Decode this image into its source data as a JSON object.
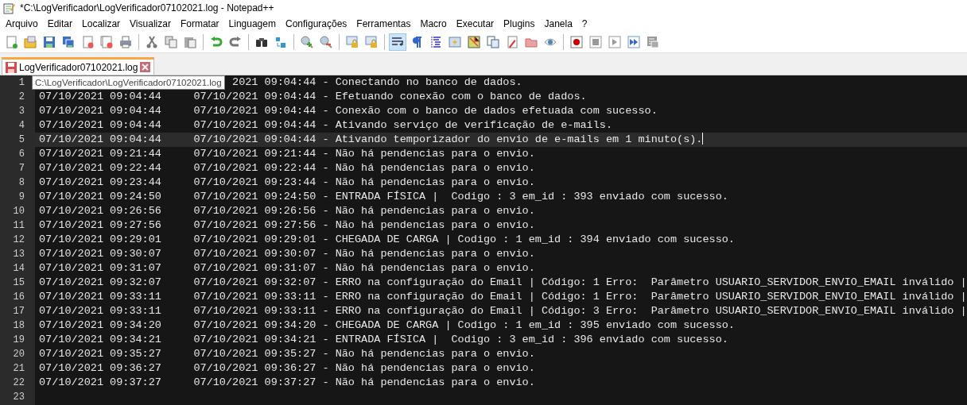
{
  "window": {
    "title": "*C:\\LogVerificador\\LogVerificador07102021.log - Notepad++"
  },
  "menu": [
    "Arquivo",
    "Editar",
    "Localizar",
    "Visualizar",
    "Formatar",
    "Linguagem",
    "Configurações",
    "Ferramentas",
    "Macro",
    "Executar",
    "Plugins",
    "Janela",
    "?"
  ],
  "toolbar": {
    "word_wrap_pressed": true
  },
  "tabs": [
    {
      "label": "LogVerificador07102021.log",
      "selected": true,
      "modified": true
    }
  ],
  "tooltip": "C:\\LogVerificador\\LogVerificador07102021.log",
  "lines": [
    {
      "number": "1",
      "text": "2021 09:04:44 - Conectando no banco de dados.",
      "partly_covered": true,
      "current": false
    },
    {
      "number": "2",
      "text": "07/10/2021 09:04:44\t07/10/2021 09:04:44 - Efetuando conexão com o banco de dados.",
      "partly_covered": false,
      "current": false
    },
    {
      "number": "3",
      "text": "07/10/2021 09:04:44\t07/10/2021 09:04:44 - Conexão com o banco de dados efetuada com sucesso.",
      "partly_covered": false,
      "current": false
    },
    {
      "number": "4",
      "text": "07/10/2021 09:04:44\t07/10/2021 09:04:44 - Ativando serviço de verificação de e-mails.",
      "partly_covered": false,
      "current": false
    },
    {
      "number": "5",
      "text": "07/10/2021 09:04:44\t07/10/2021 09:04:44 - Ativando temporizador do envio de e-mails em 1 minuto(s).",
      "partly_covered": false,
      "current": true
    },
    {
      "number": "6",
      "text": "07/10/2021 09:21:44\t07/10/2021 09:21:44 - Não há pendencias para o envio.",
      "partly_covered": false,
      "current": false
    },
    {
      "number": "7",
      "text": "07/10/2021 09:22:44\t07/10/2021 09:22:44 - Não há pendencias para o envio.",
      "partly_covered": false,
      "current": false
    },
    {
      "number": "8",
      "text": "07/10/2021 09:23:44\t07/10/2021 09:23:44 - Não há pendencias para o envio.",
      "partly_covered": false,
      "current": false
    },
    {
      "number": "9",
      "text": "07/10/2021 09:24:50\t07/10/2021 09:24:50 - ENTRADA FÍSICA |  Codigo : 3 em_id : 393 enviado com sucesso.",
      "partly_covered": false,
      "current": false
    },
    {
      "number": "10",
      "text": "07/10/2021 09:26:56\t07/10/2021 09:26:56 - Não há pendencias para o envio.",
      "partly_covered": false,
      "current": false
    },
    {
      "number": "11",
      "text": "07/10/2021 09:27:56\t07/10/2021 09:27:56 - Não há pendencias para o envio.",
      "partly_covered": false,
      "current": false
    },
    {
      "number": "12",
      "text": "07/10/2021 09:29:01\t07/10/2021 09:29:01 - CHEGADA DE CARGA | Codigo : 1 em_id : 394 enviado com sucesso.",
      "partly_covered": false,
      "current": false
    },
    {
      "number": "13",
      "text": "07/10/2021 09:30:07\t07/10/2021 09:30:07 - Não há pendencias para o envio.",
      "partly_covered": false,
      "current": false
    },
    {
      "number": "14",
      "text": "07/10/2021 09:31:07\t07/10/2021 09:31:07 - Não há pendencias para o envio.",
      "partly_covered": false,
      "current": false
    },
    {
      "number": "15",
      "text": "07/10/2021 09:32:07\t07/10/2021 09:32:07 - ERRO na configuração do Email | Código: 1 Erro:  Parâmetro USUARIO_SERVIDOR_ENVIO_EMAIL inválido |",
      "partly_covered": false,
      "current": false
    },
    {
      "number": "16",
      "text": "07/10/2021 09:33:11\t07/10/2021 09:33:11 - ERRO na configuração do Email | Código: 1 Erro:  Parâmetro USUARIO_SERVIDOR_ENVIO_EMAIL inválido |",
      "partly_covered": false,
      "current": false
    },
    {
      "number": "17",
      "text": "07/10/2021 09:33:11\t07/10/2021 09:33:11 - ERRO na configuração do Email | Código: 3 Erro:  Parâmetro USUARIO_SERVIDOR_ENVIO_EMAIL inválido |",
      "partly_covered": false,
      "current": false
    },
    {
      "number": "18",
      "text": "07/10/2021 09:34:20\t07/10/2021 09:34:20 - CHEGADA DE CARGA | Codigo : 1 em_id : 395 enviado com sucesso.",
      "partly_covered": false,
      "current": false
    },
    {
      "number": "19",
      "text": "07/10/2021 09:34:21\t07/10/2021 09:34:21 - ENTRADA FÍSICA |  Codigo : 3 em_id : 396 enviado com sucesso.",
      "partly_covered": false,
      "current": false
    },
    {
      "number": "20",
      "text": "07/10/2021 09:35:27\t07/10/2021 09:35:27 - Não há pendencias para o envio.",
      "partly_covered": false,
      "current": false
    },
    {
      "number": "21",
      "text": "07/10/2021 09:36:27\t07/10/2021 09:36:27 - Não há pendencias para o envio.",
      "partly_covered": false,
      "current": false
    },
    {
      "number": "22",
      "text": "07/10/2021 09:37:27\t07/10/2021 09:37:27 - Não há pendencias para o envio.",
      "partly_covered": false,
      "current": false
    },
    {
      "number": "23",
      "current": false
    }
  ]
}
